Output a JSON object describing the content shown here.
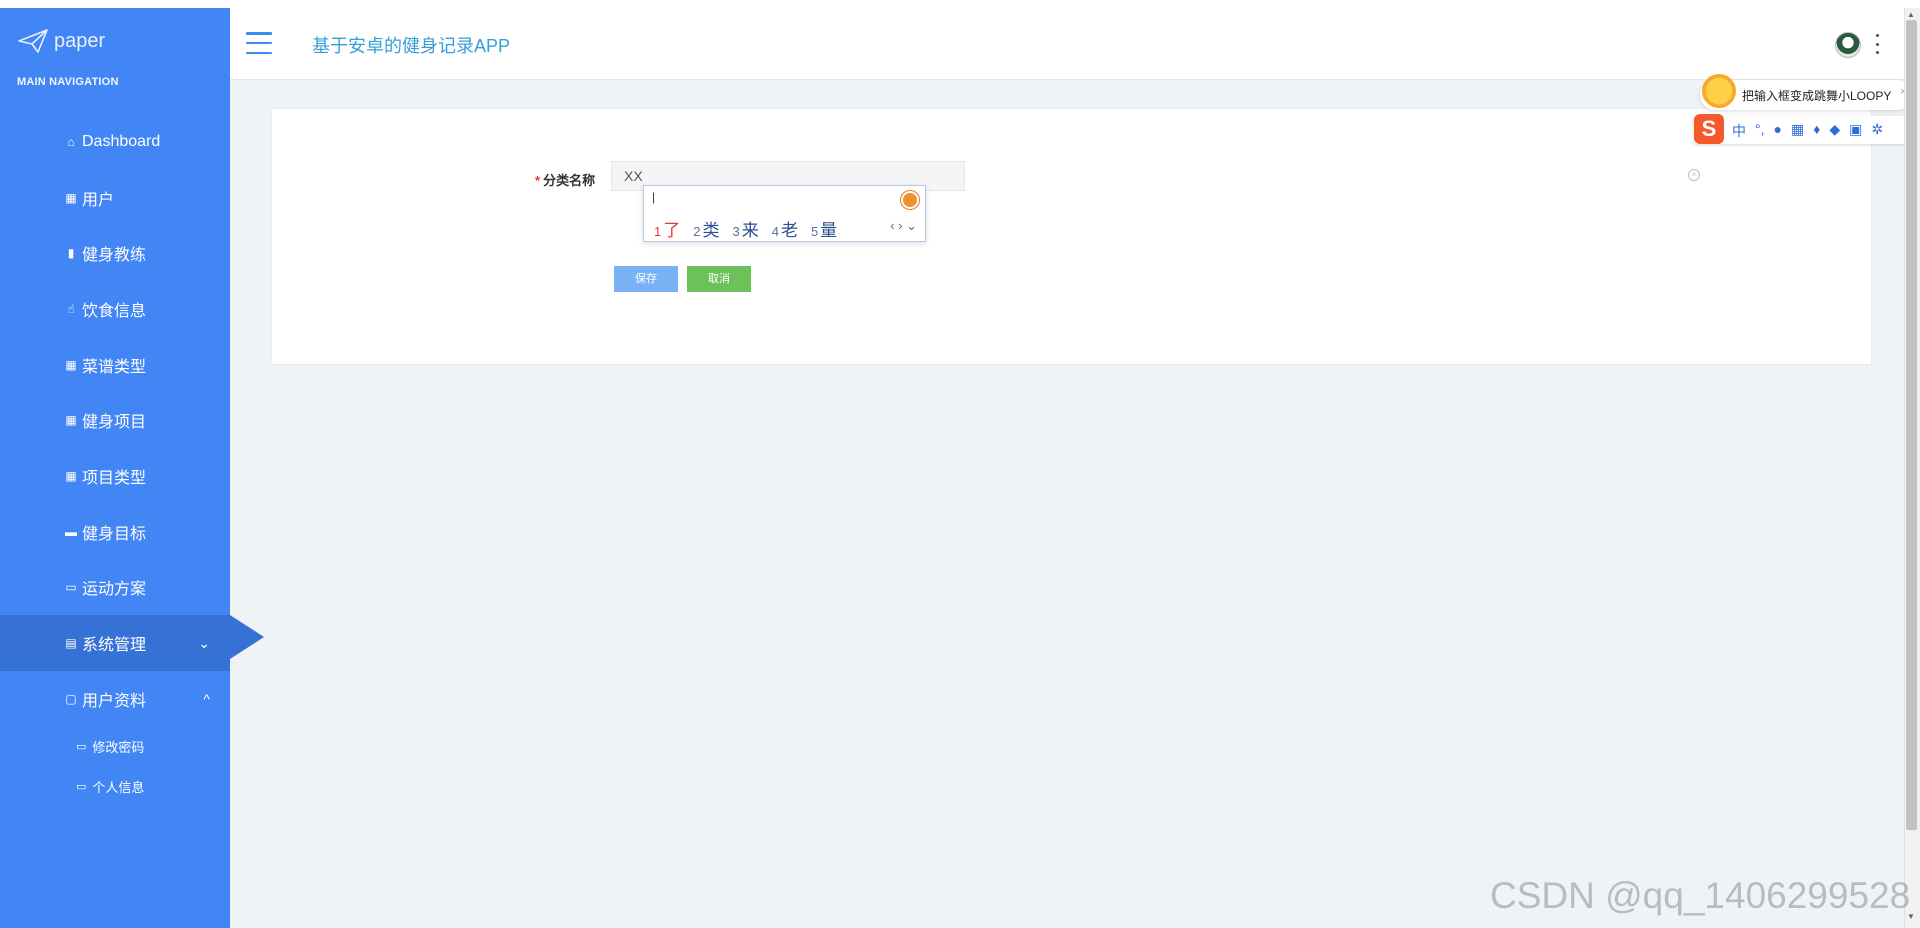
{
  "brand": {
    "logo_text": "paper"
  },
  "sidebar": {
    "section_title": "MAIN NAVIGATION",
    "items": [
      {
        "label": "Dashboard",
        "icon": "home-icon"
      },
      {
        "label": "用户",
        "icon": "grid-icon"
      },
      {
        "label": "健身教练",
        "icon": "bar-chart-icon"
      },
      {
        "label": "饮食信息",
        "icon": "thumbs-up-icon"
      },
      {
        "label": "菜谱类型",
        "icon": "grid-icon"
      },
      {
        "label": "健身项目",
        "icon": "grid-icon"
      },
      {
        "label": "项目类型",
        "icon": "grid-icon"
      },
      {
        "label": "健身目标",
        "icon": "monitor-icon"
      },
      {
        "label": "运动方案",
        "icon": "briefcase-icon"
      },
      {
        "label": "系统管理",
        "icon": "clipboard-icon"
      },
      {
        "label": "用户资料",
        "icon": "calendar-icon"
      }
    ],
    "sub_items": [
      {
        "label": "修改密码",
        "icon": "folder-icon"
      },
      {
        "label": "个人信息",
        "icon": "folder-icon"
      }
    ]
  },
  "header": {
    "app_title": "基于安卓的健身记录APP"
  },
  "form": {
    "required_mark": "*",
    "field_label": "分类名称",
    "field_value": "XX",
    "save_label": "保存",
    "cancel_label": "取消"
  },
  "ime": {
    "candidates": [
      {
        "n": "1",
        "t": "了"
      },
      {
        "n": "2",
        "t": "类"
      },
      {
        "n": "3",
        "t": "来"
      },
      {
        "n": "4",
        "t": "老"
      },
      {
        "n": "5",
        "t": "量"
      }
    ],
    "nav": "‹ › ⌄"
  },
  "sogou": {
    "tip": "把输入框变成跳舞小LOOPY",
    "logo": "S",
    "mode": "中"
  },
  "watermark": "CSDN @qq_1406299528",
  "colors": {
    "sidebar": "#4285f4",
    "active": "#3672d6",
    "title": "#35a0d8",
    "save": "#7ab3f5",
    "cancel": "#6cc158"
  }
}
